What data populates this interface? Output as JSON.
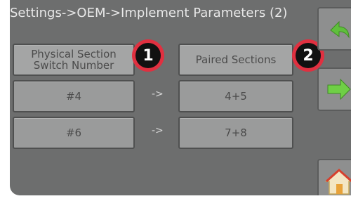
{
  "title": "Settings->OEM->Implement Parameters (2)",
  "headers": {
    "physical": [
      "Physical Section",
      "Switch Number"
    ],
    "paired": "Paired Sections"
  },
  "rows": [
    {
      "switch": "#4",
      "arrow": "->",
      "paired": "4+5"
    },
    {
      "switch": "#6",
      "arrow": "->",
      "paired": "7+8"
    }
  ],
  "callouts": [
    "1",
    "2"
  ],
  "icons": {
    "back": "back-arrow-icon",
    "forward": "forward-arrow-icon",
    "home": "home-icon"
  },
  "colors": {
    "screen_bg": "#6d6e6e",
    "button_bg": "#9a9b9b",
    "accent_green": "#5fbf3c",
    "callout_red": "#e03040"
  }
}
